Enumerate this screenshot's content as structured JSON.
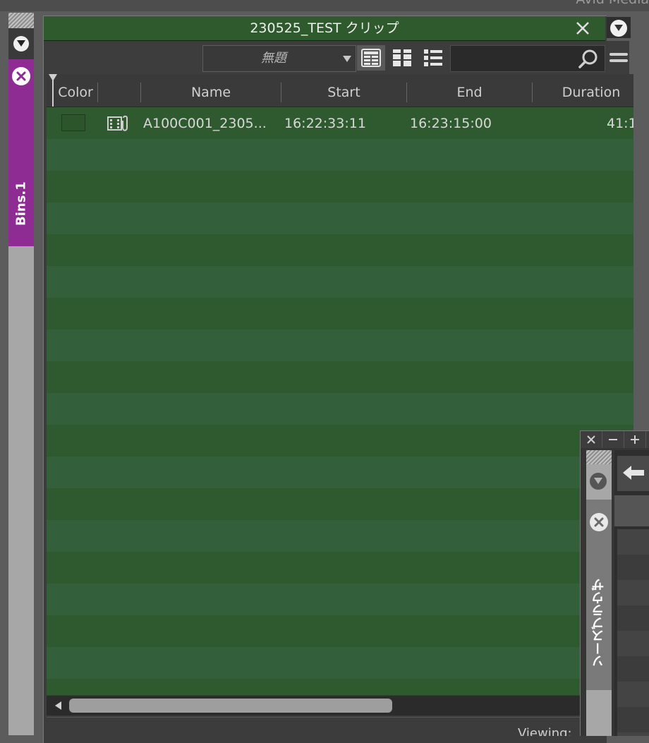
{
  "app": {
    "title": "Avid Media"
  },
  "left_dock": {
    "tab_label": "Bins.1"
  },
  "bin": {
    "title": "230525_TEST クリップ",
    "view_name": "無題",
    "search_placeholder": "",
    "columns": [
      "Color",
      "",
      "Name",
      "Start",
      "End",
      "Duration"
    ],
    "rows": [
      {
        "color": "#2c552c",
        "icon": "clip-icon",
        "name": "A100C001_2305...",
        "start": "16:22:33:11",
        "end": "16:23:15:00",
        "duration": "41:1"
      }
    ],
    "footer_text": "Viewing: "
  },
  "source_browser": {
    "tab_label": "ソースブラウザ"
  },
  "colors": {
    "bin_title": "#2f5a2e",
    "bin_rows": "#2f5a2f",
    "bins_tab": "#8e2c94"
  }
}
